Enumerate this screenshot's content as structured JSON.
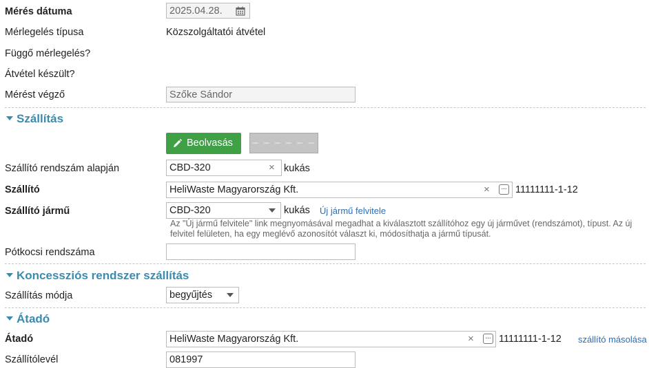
{
  "fields": {
    "meres_datuma": {
      "label": "Mérés dátuma",
      "value": "2025.04.28."
    },
    "merleges_tipusa": {
      "label": "Mérlegelés típusa",
      "value": "Közszolgáltatói átvétel"
    },
    "fuggo": {
      "label": "Függő mérlegelés?"
    },
    "atvetel": {
      "label": "Átvétel készült?"
    },
    "merest_vegzo": {
      "label": "Mérést végző",
      "value": "Szőke Sándor"
    }
  },
  "szallitas": {
    "title": "Szállítás",
    "beolvasas_label": "Beolvasás",
    "dashes_label": "– – – – – –",
    "rendszam": {
      "label": "Szállító rendszám alapján",
      "value": "CBD-320",
      "suffix": "kukás"
    },
    "szallito": {
      "label": "Szállító",
      "value": "HeliWaste Magyarország Kft.",
      "tax": "11111111-1-12"
    },
    "jarmu": {
      "label": "Szállító jármű",
      "value": "CBD-320",
      "suffix": "kukás",
      "link": "Új jármű felvitele",
      "hint": "Az \"Új jármű felvitele\" link megnyomásával megadhat a kiválasztott szállítóhoz egy új járművet (rendszámot), típust. Az új felvitel felületen, ha egy meglévő azonosítót választ ki, módosíthatja a jármű típusát."
    },
    "potkocsi": {
      "label": "Pótkocsi rendszáma",
      "value": ""
    }
  },
  "koncesszio": {
    "title": "Koncessziós rendszer szállítás",
    "mod": {
      "label": "Szállítás módja",
      "value": "begyűjtés"
    }
  },
  "atado": {
    "title": "Átadó",
    "atado": {
      "label": "Átadó",
      "value": "HeliWaste Magyarország Kft.",
      "tax": "11111111-1-12",
      "link": "szállító másolása"
    },
    "szallitolevel": {
      "label": "Szállítólevél",
      "value": "081997"
    }
  }
}
